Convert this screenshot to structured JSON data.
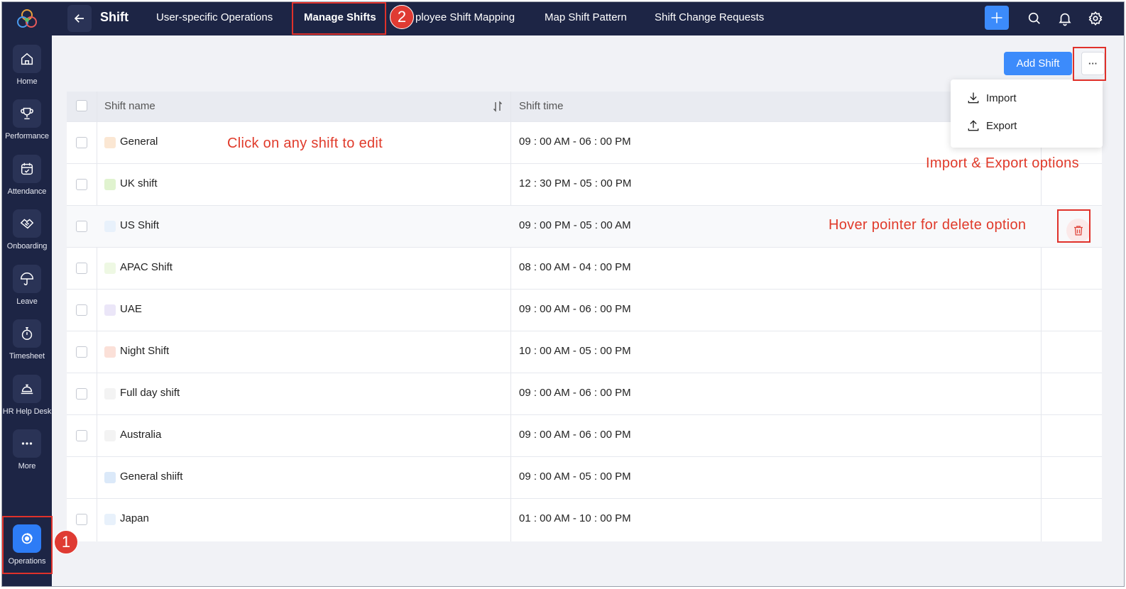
{
  "sidebar": {
    "items": [
      {
        "label": "Home",
        "icon": "home-icon"
      },
      {
        "label": "Performance",
        "icon": "trophy-icon"
      },
      {
        "label": "Attendance",
        "icon": "calendar-check-icon"
      },
      {
        "label": "Onboarding",
        "icon": "handshake-icon"
      },
      {
        "label": "Leave",
        "icon": "umbrella-icon"
      },
      {
        "label": "Timesheet",
        "icon": "stopwatch-icon"
      },
      {
        "label": "HR Help Desk",
        "icon": "service-bell-icon"
      },
      {
        "label": "More",
        "icon": "more-dots-icon"
      }
    ],
    "active": {
      "label": "Operations",
      "icon": "operations-icon"
    }
  },
  "header": {
    "title": "Shift",
    "tabs": [
      {
        "label": "User-specific Operations"
      },
      {
        "label": "Manage Shifts"
      },
      {
        "label": "ployee Shift Mapping"
      },
      {
        "label": "Map Shift Pattern"
      },
      {
        "label": "Shift Change Requests"
      }
    ],
    "active_tab": "Manage Shifts"
  },
  "toolbar": {
    "add_shift_label": "Add Shift",
    "more_label": "···"
  },
  "table": {
    "columns": {
      "name": "Shift name",
      "time": "Shift time"
    },
    "rows": [
      {
        "name": "General",
        "time": "09 : 00 AM - 06 : 00 PM",
        "color": "#fbe7d3"
      },
      {
        "name": "UK shift",
        "time": "12 : 30 PM - 05 : 00 PM",
        "color": "#e0f3cf"
      },
      {
        "name": "US Shift",
        "time": "09 : 00 PM - 05 : 00 AM",
        "color": "#e8f1fb"
      },
      {
        "name": "APAC Shift",
        "time": "08 : 00 AM - 04 : 00 PM",
        "color": "#eef8e3"
      },
      {
        "name": "UAE",
        "time": "09 : 00 AM - 06 : 00 PM",
        "color": "#ebe6f8"
      },
      {
        "name": "Night Shift",
        "time": "10 : 00 AM - 05 : 00 PM",
        "color": "#fbe0d8"
      },
      {
        "name": "Full day shift",
        "time": "09 : 00 AM - 06 : 00 PM",
        "color": "#f3f3f3"
      },
      {
        "name": "Australia",
        "time": "09 : 00 AM - 06 : 00 PM",
        "color": "#f3f3f3"
      },
      {
        "name": "General shiift",
        "time": "09 : 00 AM - 05 : 00 PM",
        "color": "#dbe9f9"
      },
      {
        "name": "Japan",
        "time": "01 : 00 AM - 10 : 00 PM",
        "color": "#e8f1fb"
      }
    ]
  },
  "dropdown": {
    "import_label": "Import",
    "export_label": "Export"
  },
  "annotations": {
    "edit_note": "Click on any shift to edit",
    "import_export_note": "Import & Export options",
    "delete_note": "Hover pointer for delete option",
    "badge1": "1",
    "badge2": "2"
  },
  "colors": {
    "navy": "#1d2545",
    "accent_blue": "#3c8bfb",
    "annotation_red": "#e03a2a"
  }
}
